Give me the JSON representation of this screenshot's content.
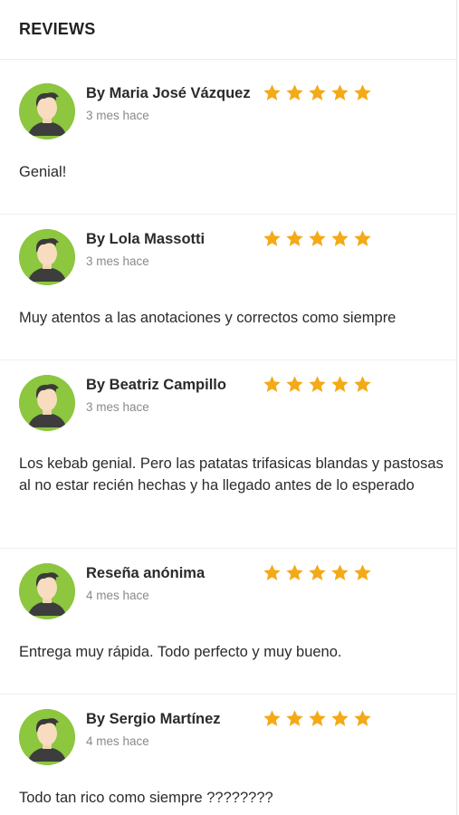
{
  "header": {
    "title": "REVIEWS"
  },
  "colors": {
    "star": "#f4a916",
    "avatar_bg": "#8dc63f"
  },
  "reviews": [
    {
      "author": "By Maria José Vázquez",
      "date": "3 mes hace",
      "rating": 5,
      "text": "Genial!"
    },
    {
      "author": "By Lola Massotti",
      "date": "3 mes hace",
      "rating": 5,
      "text": "Muy atentos a las anotaciones y correctos como siempre"
    },
    {
      "author": "By Beatriz Campillo",
      "date": "3 mes hace",
      "rating": 5,
      "text": "Los kebab genial. Pero las patatas trifasicas blandas y pastosas al no estar recién hechas y ha llegado antes de lo esperado"
    },
    {
      "author": "Reseña anónima",
      "date": "4 mes hace",
      "rating": 5,
      "text": "Entrega muy rápida. Todo perfecto y muy bueno."
    },
    {
      "author": "By Sergio Martínez",
      "date": "4 mes hace",
      "rating": 5,
      "text": "Todo tan rico como siempre ????????"
    }
  ]
}
